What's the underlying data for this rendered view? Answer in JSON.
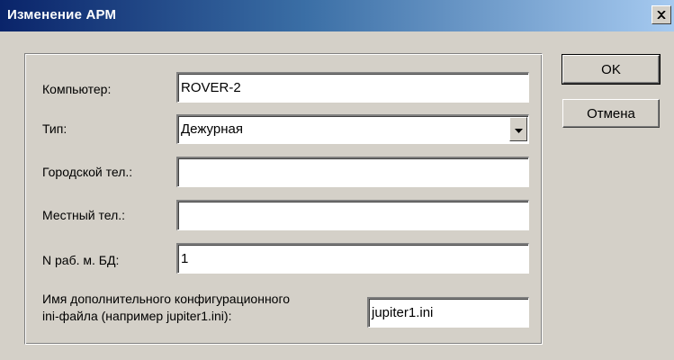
{
  "window": {
    "title": "Изменение АРМ"
  },
  "buttons": {
    "ok": "OK",
    "cancel": "Отмена"
  },
  "form": {
    "computer": {
      "label": "Компьютер:",
      "value": "ROVER-2"
    },
    "type": {
      "label": "Тип:",
      "value": "Дежурная"
    },
    "city_phone": {
      "label": "Городской тел.:",
      "value": ""
    },
    "local_phone": {
      "label": "Местный тел.:",
      "value": ""
    },
    "db_workplace": {
      "label": "N раб. м. БД:",
      "value": "1"
    },
    "ini_file": {
      "label_line1": "Имя дополнительного конфигурационного",
      "label_line2": "ini-файла (например jupiter1.ini):",
      "value": "jupiter1.ini"
    }
  },
  "icons": {
    "close": "close-icon",
    "dropdown": "chevron-down-icon"
  }
}
